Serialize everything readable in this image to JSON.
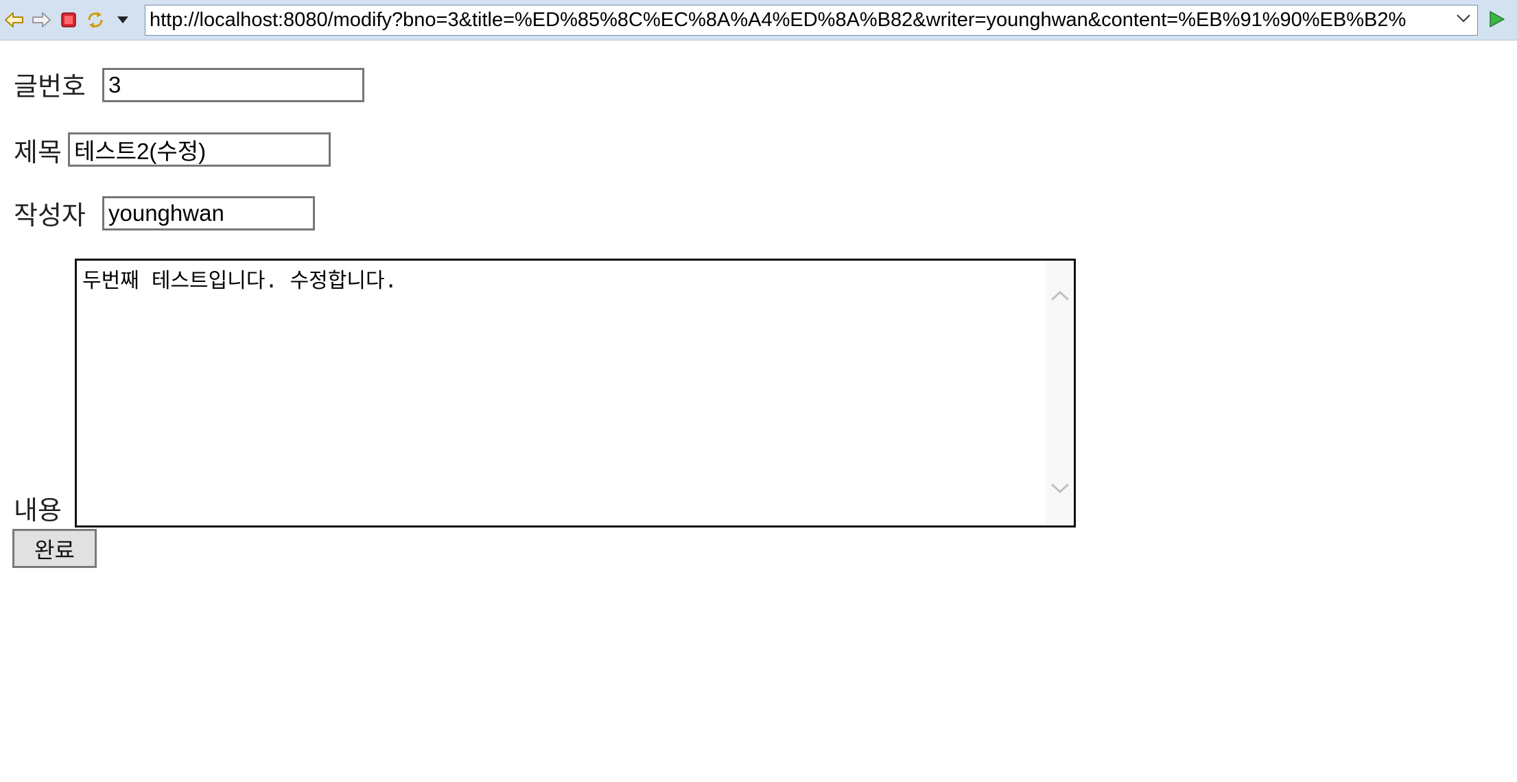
{
  "browser": {
    "url": "http://localhost:8080/modify?bno=3&title=%ED%85%8C%EC%8A%A4%ED%8A%B82&writer=younghwan&content=%EB%91%90%EB%B2%"
  },
  "form": {
    "bno_label": "글번호",
    "bno_value": "3",
    "title_label": "제목",
    "title_value": "테스트2(수정)",
    "writer_label": "작성자",
    "writer_value": "younghwan",
    "content_label": "내용",
    "content_value": "두번째 테스트입니다. 수정합니다.",
    "submit_label": "완료"
  }
}
